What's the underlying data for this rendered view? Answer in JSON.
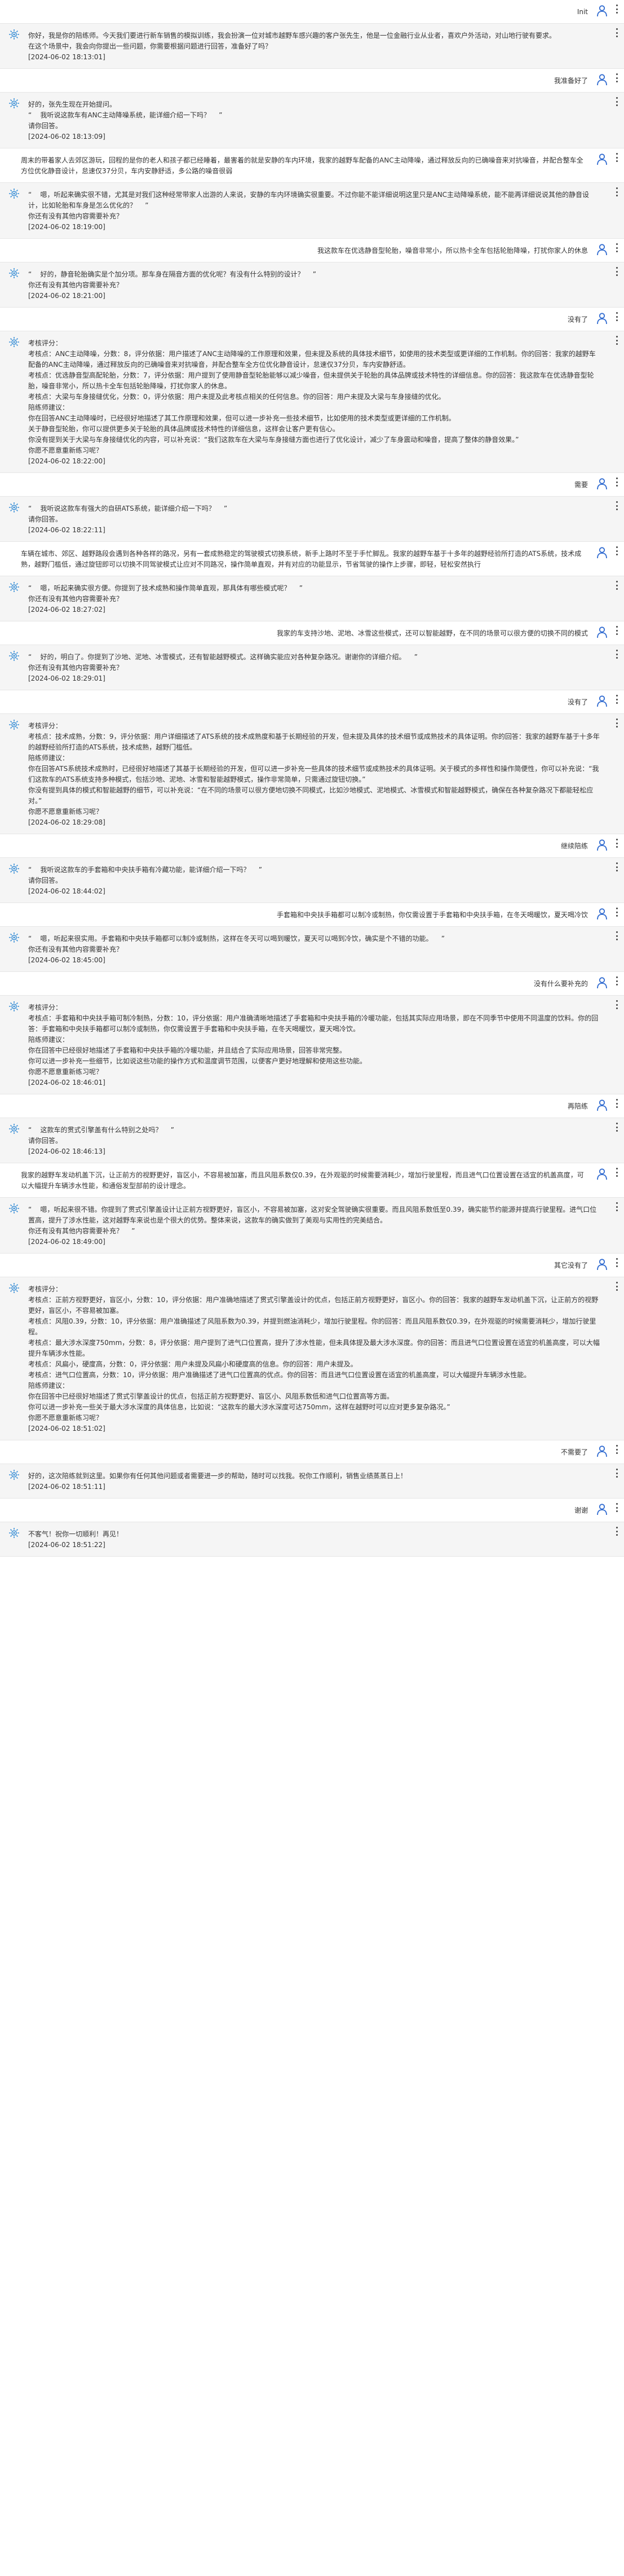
{
  "colors": {
    "user_bg": "#ffffff",
    "bot_bg": "#f5f5f5",
    "user_icon": "#2f6ad0",
    "bot_icon": "#3a8fd6"
  },
  "icons": {
    "user": "user-icon",
    "bot": "bot-icon",
    "menu": "more-vertical-icon"
  },
  "messages": [
    {
      "role": "user",
      "text": "Init"
    },
    {
      "role": "bot",
      "text": "你好，我是你的陪练师。今天我们要进行新车销售的模拟训练，我会扮演一位对城市越野车感兴趣的客户张先生，他是一位金融行业从业者，喜欢户外活动，对山地行驶有要求。\n在这个场景中，我会向你提出一些问题，你需要根据问题进行回答，准备好了吗？\n[2024-06-02 18:13:01]"
    },
    {
      "role": "user",
      "text": "我准备好了"
    },
    {
      "role": "bot",
      "text": "好的，张先生现在开始提问。\n“    我听说这款车有ANC主动降噪系统，能详细介绍一下吗？    ”\n请你回答。\n[2024-06-02 18:13:09]"
    },
    {
      "role": "user",
      "text": "周末的带着家人去郊区游玩，回程的是你的老人和孩子都已经睡着，最害着的就是安静的车内环境，我家的越野车配备的ANC主动降噪，通过释放反向的已确噪音来对抗噪音，并配合整车全方位优化静音设计，怠速仅37分贝，车内安静舒适，多公路的噪音很弱"
    },
    {
      "role": "bot",
      "text": "“    嗯，听起来确实很不错，尤其是对我们这种经常带家人出游的人来说，安静的车内环境确实很重要。不过你能不能详细说明这里只是ANC主动降噪系统，能不能再详细说说其他的静音设计，比如轮胎和车身是怎么优化的？    ”\n你还有没有其他内容需要补充？\n[2024-06-02 18:19:00]"
    },
    {
      "role": "user",
      "text": "我这款车在优选静音型轮胎，噪音非常小，所以热卡全车包括轮胎降噪，打扰你家人的休息"
    },
    {
      "role": "bot",
      "text": "“    好的，静音轮胎确实是个加分项。那车身在隔音方面的优化呢？有没有什么特别的设计？    ”\n你还有没有其他内容需要补充？\n[2024-06-02 18:21:00]"
    },
    {
      "role": "user",
      "text": "没有了"
    },
    {
      "role": "bot",
      "text": "考核评分：\n考核点：ANC主动降噪，分数：8，评分依据：用户描述了ANC主动降噪的工作原理和效果，但未提及系统的具体技术细节，如使用的技术类型或更详细的工作机制。你的回答：我家的越野车配备的ANC主动降噪，通过释放反向的已确噪音来对抗噪音，并配合整车全方位优化静音设计，怠速仅37分贝，车内安静舒适。\n考核点：优选静音型高配轮胎，分数：7，评分依据：用户提到了使用静音型轮胎能够以减少噪音，但未提供关于轮胎的具体品牌或技术特性的详细信息。你的回答：我这款车在优选静音型轮胎，噪音非常小，所以热卡全车包括轮胎降噪，打扰你家人的休息。\n考核点：大梁与车身接缝优化，分数：0，评分依据：用户未提及此考核点相关的任何信息。你的回答：用户未提及大梁与车身接缝的优化。\n陪练师建议：\n你在回答ANC主动降噪时，已经很好地描述了其工作原理和效果，但可以进一步补充一些技术细节，比如使用的技术类型或更详细的工作机制。\n关于静音型轮胎，你可以提供更多关于轮胎的具体品牌或技术特性的详细信息，这样会让客户更有信心。\n你没有提到关于大梁与车身接缝优化的内容，可以补充说：“我们这款车在大梁与车身接缝方面也进行了优化设计，减少了车身震动和噪音，提高了整体的静音效果。”\n你愿不愿意重新练习呢？\n[2024-06-02 18:22:00]"
    },
    {
      "role": "user",
      "text": "需要"
    },
    {
      "role": "bot",
      "text": "“    我听说这款车有强大的自研ATS系统，能详细介绍一下吗？    ”\n请你回答。\n[2024-06-02 18:22:11]"
    },
    {
      "role": "user",
      "text": "车辆在城市、郊区、越野路段会遇到各种各样的路况，另有一套成熟稳定的驾驶模式切换系统，新手上路时不至于手忙脚乱。我家的越野车基于十多年的越野经验所打造的ATS系统，技术成熟，越野门槛低，通过旋钮即可以切换不同驾驶模式让应对不同路况，操作简单直观，并有对应的功能显示，节省驾驶的操作上步骤，即轻，轻松安然执行"
    },
    {
      "role": "bot",
      "text": "“    嗯，听起来确实很方便。你提到了技术成熟和操作简单直观，那具体有哪些模式呢？    ”\n你还有没有其他内容需要补充？\n[2024-06-02 18:27:02]"
    },
    {
      "role": "user",
      "text": "我家的车支持沙地、泥地、冰雪这些模式，还可以智能越野，在不同的场景可以很方便的切换不同的模式"
    },
    {
      "role": "bot",
      "text": "“    好的，明白了。你提到了沙地、泥地、冰雪模式，还有智能越野模式。这样确实能应对各种复杂路况。谢谢你的详细介绍。    ”\n你还有没有其他内容需要补充？\n[2024-06-02 18:29:01]"
    },
    {
      "role": "user",
      "text": "没有了"
    },
    {
      "role": "bot",
      "text": "考核评分：\n考核点：技术成熟，分数：9，评分依据：用户详细描述了ATS系统的技术成熟度和基于长期经验的开发，但未提及具体的技术细节或成熟技术的具体证明。你的回答：我家的越野车基于十多年的越野经验所打造的ATS系统，技术成熟，越野门槛低。\n陪练师建议：\n你在回答ATS系统技术成熟时，已经很好地描述了其基于长期经验的开发，但可以进一步补充一些具体的技术细节或成熟技术的具体证明。关于模式的多样性和操作简便性，你可以补充说：“我们这款车的ATS系统支持多种模式，包括沙地、泥地、冰雪和智能越野模式，操作非常简单，只需通过旋钮切换。”\n你没有提到具体的模式和智能越野的细节，可以补充说：“在不同的场景可以很方便地切换不同模式，比如沙地模式、泥地模式、冰雪模式和智能越野模式，确保在各种复杂路况下都能轻松应对。”\n你愿不愿意重新练习呢？\n[2024-06-02 18:29:08]"
    },
    {
      "role": "user",
      "text": "继续陪练"
    },
    {
      "role": "bot",
      "text": "“    我听说这款车的手套箱和中央扶手箱有冷藏功能，能详细介绍一下吗？    ”\n请你回答。\n[2024-06-02 18:44:02]"
    },
    {
      "role": "user",
      "text": "手套箱和中央扶手箱都可以制冷或制热，你仅需设置于手套箱和中央扶手箱，在冬天喝暖饮，夏天喝冷饮"
    },
    {
      "role": "bot",
      "text": "“    嗯，听起来很实用。手套箱和中央扶手箱都可以制冷或制热，这样在冬天可以喝到暖饮，夏天可以喝到冷饮，确实是个不错的功能。    ”\n你还有没有其他内容需要补充？\n[2024-06-02 18:45:00]"
    },
    {
      "role": "user",
      "text": "没有什么要补充的"
    },
    {
      "role": "bot",
      "text": "考核评分：\n考核点：手套箱和中央扶手箱可制冷制热，分数：10，评分依据：用户准确清晰地描述了手套箱和中央扶手箱的冷暖功能，包括其实际应用场景，即在不同季节中使用不同温度的饮料。你的回答：手套箱和中央扶手箱都可以制冷或制热，你仅需设置于手套箱和中央扶手箱，在冬天喝暖饮，夏天喝冷饮。\n陪练师建议：\n你在回答中已经很好地描述了手套箱和中央扶手箱的冷暖功能，并且结合了实际应用场景，回答非常完整。\n你可以进一步补充一些细节，比如说这些功能的操作方式和温度调节范围，以便客户更好地理解和使用这些功能。\n你愿不愿意重新练习呢？\n[2024-06-02 18:46:01]"
    },
    {
      "role": "user",
      "text": "再陪练"
    },
    {
      "role": "bot",
      "text": "“    这款车的贯式引擎盖有什么特别之处吗？    ”\n请你回答。\n[2024-06-02 18:46:13]"
    },
    {
      "role": "user",
      "text": "我家的越野车发动机盖下沉，让正前方的视野更好，盲区小，不容易被加塞，而且风阻系数仅0.39，在外观驱的时候需要消耗少，增加行驶里程，而且进气口位置设置在适宜的机盖高度，可以大幅提升车辆涉水性能，和通俗发型部前的设计理念。"
    },
    {
      "role": "bot",
      "text": "“    嗯，听起来很不错。你提到了贯式引擎盖设计让正前方视野更好，盲区小，不容易被加塞，这对安全驾驶确实很重要。而且风阻系数低至0.39，确实能节约能源并提高行驶里程。进气口位置高，提升了涉水性能，这对越野车来说也是个很大的优势。整体来说，这款车的确实做到了美观与实用性的完美结合。\n你还有没有其他内容需要补充？    ”\n[2024-06-02 18:49:00]"
    },
    {
      "role": "user",
      "text": "其它没有了"
    },
    {
      "role": "bot",
      "text": "考核评分：\n考核点：正前方视野更好，盲区小，分数：10，评分依据：用户准确地描述了贯式引擎盖设计的优点，包括正前方视野更好，盲区小。你的回答：我家的越野车发动机盖下沉，让正前方的视野更好，盲区小，不容易被加塞。\n考核点：风阻0.39，分数：10，评分依据：用户准确描述了风阻系数为0.39，并提到燃油消耗少，增加行驶里程。你的回答：而且风阻系数仅0.39，在外观驱的时候需要消耗少，增加行驶里程。\n考核点：最大涉水深度750mm，分数：8，评分依据：用户提到了进气口位置高，提升了涉水性能，但未具体提及最大涉水深度。你的回答：而且进气口位置设置在适宜的机盖高度，可以大幅提升车辆涉水性能。\n考核点：风扁小，硬度高，分数：0，评分依据：用户未提及风扁小和硬度高的信息。你的回答：用户未提及。\n考核点：进气口位置高，分数：10，评分依据：用户准确描述了进气口位置高的优点。你的回答：而且进气口位置设置在适宜的机盖高度，可以大幅提升车辆涉水性能。\n陪练师建议：\n你在回答中已经很好地描述了贯式引擎盖设计的优点，包括正前方视野更好、盲区小、风阻系数低和进气口位置高等方面。\n你可以进一步补充一些关于最大涉水深度的具体信息，比如说：“这款车的最大涉水深度可达750mm，这样在越野时可以应对更多复杂路况。”\n你愿不愿意重新练习呢？\n[2024-06-02 18:51:02]"
    },
    {
      "role": "user",
      "text": "不需要了"
    },
    {
      "role": "bot",
      "text": "好的，这次陪练就到这里。如果你有任何其他问题或者需要进一步的帮助，随时可以找我。祝你工作顺利，销售业绩蒸蒸日上！\n[2024-06-02 18:51:11]"
    },
    {
      "role": "user",
      "text": "谢谢"
    },
    {
      "role": "bot",
      "text": "不客气！祝你一切顺利！再见！\n[2024-06-02 18:51:22]"
    }
  ]
}
